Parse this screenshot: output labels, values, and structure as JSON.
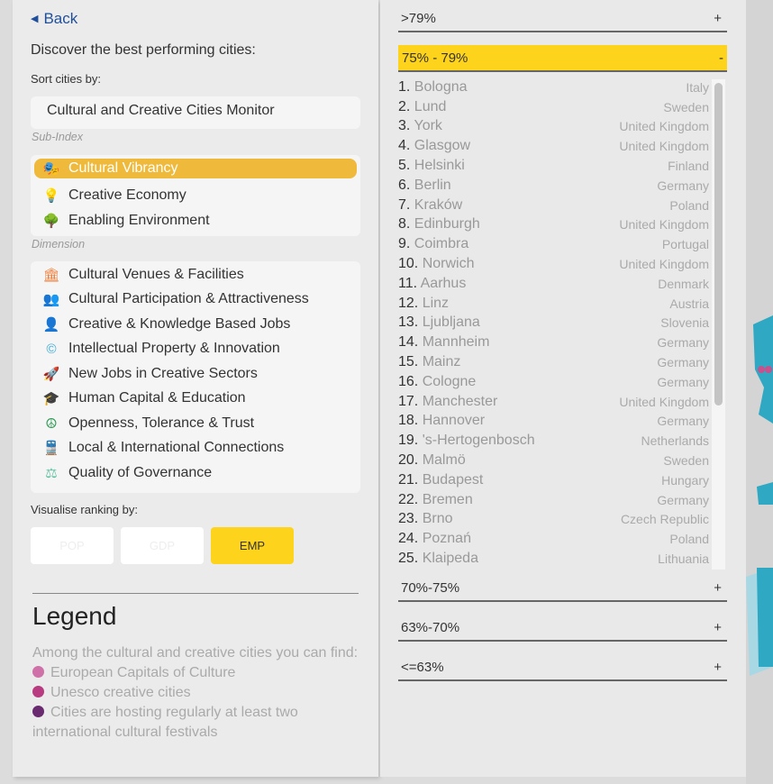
{
  "back_label": "Back",
  "heading": "Discover the best performing cities:",
  "sort_label": "Sort cities by:",
  "sort_value": "Cultural and Creative Cities Monitor",
  "subindex_label": "Sub-Index",
  "subindex": [
    {
      "label": "Cultural Vibrancy",
      "icon": "theatre-masks-icon",
      "color": "#ffffff",
      "active": true
    },
    {
      "label": "Creative Economy",
      "icon": "lightbulb-icon",
      "color": "#3a9ad6"
    },
    {
      "label": "Enabling Environment",
      "icon": "trees-icon",
      "color": "#1e7a3c"
    }
  ],
  "dimension_label": "Dimension",
  "dimensions": [
    {
      "label": "Cultural Venues & Facilities",
      "icon": "museum-icon",
      "glyph": "🏛",
      "color": "#ee7c36"
    },
    {
      "label": "Cultural Participation & Attractiveness",
      "icon": "people-icon",
      "glyph": "👥",
      "color": "#f0a030"
    },
    {
      "label": "Creative & Knowledge Based Jobs",
      "icon": "person-icon",
      "glyph": "👤",
      "color": "#2a6fa8"
    },
    {
      "label": "Intellectual Property & Innovation",
      "icon": "copyright-icon",
      "glyph": "©",
      "color": "#3aa9d9"
    },
    {
      "label": "New Jobs in Creative Sectors",
      "icon": "rocket-icon",
      "glyph": "🚀",
      "color": "#5cb8e0"
    },
    {
      "label": "Human Capital & Education",
      "icon": "graduation-cap-icon",
      "glyph": "🎓",
      "color": "#1e6b35"
    },
    {
      "label": "Openness, Tolerance & Trust",
      "icon": "peace-icon",
      "glyph": "☮",
      "color": "#2f9a55"
    },
    {
      "label": "Local & International Connections",
      "icon": "train-icon",
      "glyph": "🚆",
      "color": "#3aa070"
    },
    {
      "label": "Quality of Governance",
      "icon": "gavel-icon",
      "glyph": "⚖",
      "color": "#5cc0a0"
    }
  ],
  "visualise_label": "Visualise ranking by:",
  "visualise": [
    {
      "label": "POP"
    },
    {
      "label": "GDP"
    },
    {
      "label": "EMP",
      "active": true
    }
  ],
  "legend": {
    "title": "Legend",
    "intro": "Among the cultural and creative cities you can find:",
    "items": [
      {
        "label": "European Capitals of Culture",
        "color": "#d070a8"
      },
      {
        "label": "Unesco creative cities",
        "color": "#b83a80"
      },
      {
        "label": "Cities are hosting regularly at least two international cultural festivals",
        "color": "#6a2a70"
      }
    ]
  },
  "groups": [
    {
      "label": ">79%",
      "toggle": "+"
    },
    {
      "label": "75% - 79%",
      "toggle": "-",
      "open": true
    },
    {
      "label": "70%-75%",
      "toggle": "+"
    },
    {
      "label": "63%-70%",
      "toggle": "+"
    },
    {
      "label": "<=63%",
      "toggle": "+"
    }
  ],
  "cities": [
    {
      "rank": "1.",
      "name": "Bologna",
      "country": "Italy"
    },
    {
      "rank": "2.",
      "name": "Lund",
      "country": "Sweden"
    },
    {
      "rank": "3.",
      "name": "York",
      "country": "United Kingdom"
    },
    {
      "rank": "4.",
      "name": "Glasgow",
      "country": "United Kingdom"
    },
    {
      "rank": "5.",
      "name": "Helsinki",
      "country": "Finland"
    },
    {
      "rank": "6.",
      "name": "Berlin",
      "country": "Germany"
    },
    {
      "rank": "7.",
      "name": "Kraków",
      "country": "Poland"
    },
    {
      "rank": "8.",
      "name": "Edinburgh",
      "country": "United Kingdom"
    },
    {
      "rank": "9.",
      "name": "Coimbra",
      "country": "Portugal"
    },
    {
      "rank": "10.",
      "name": "Norwich",
      "country": "United Kingdom"
    },
    {
      "rank": "11.",
      "name": "Aarhus",
      "country": "Denmark"
    },
    {
      "rank": "12.",
      "name": "Linz",
      "country": "Austria"
    },
    {
      "rank": "13.",
      "name": "Ljubljana",
      "country": "Slovenia"
    },
    {
      "rank": "14.",
      "name": "Mannheim",
      "country": "Germany"
    },
    {
      "rank": "15.",
      "name": "Mainz",
      "country": "Germany"
    },
    {
      "rank": "16.",
      "name": "Cologne",
      "country": "Germany"
    },
    {
      "rank": "17.",
      "name": "Manchester",
      "country": "United Kingdom"
    },
    {
      "rank": "18.",
      "name": "Hannover",
      "country": "Germany"
    },
    {
      "rank": "19.",
      "name": "'s-Hertogenbosch",
      "country": "Netherlands"
    },
    {
      "rank": "20.",
      "name": "Malmö",
      "country": "Sweden"
    },
    {
      "rank": "21.",
      "name": "Budapest",
      "country": "Hungary"
    },
    {
      "rank": "22.",
      "name": "Bremen",
      "country": "Germany"
    },
    {
      "rank": "23.",
      "name": "Brno",
      "country": "Czech Republic"
    },
    {
      "rank": "24.",
      "name": "Poznań",
      "country": "Poland"
    },
    {
      "rank": "25.",
      "name": "Klaipeda",
      "country": "Lithuania"
    }
  ]
}
